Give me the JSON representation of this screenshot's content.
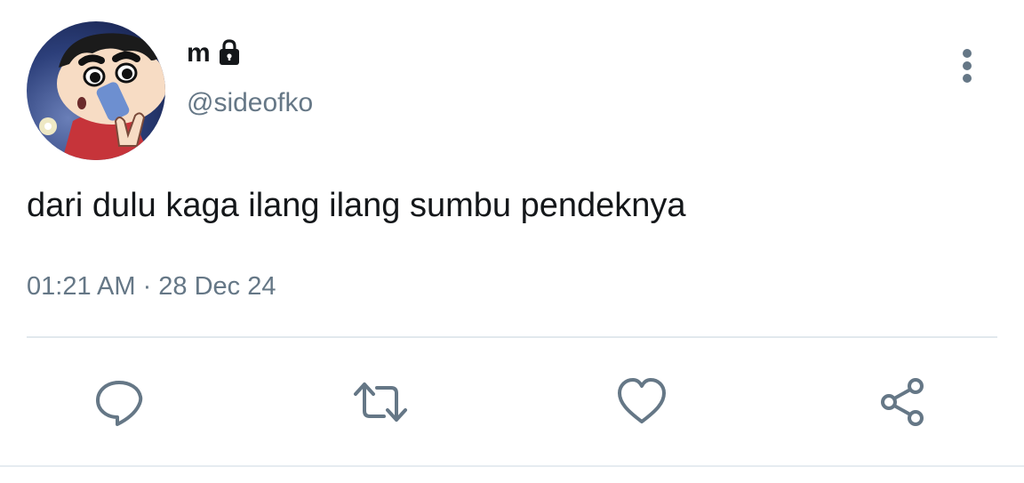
{
  "user": {
    "display_name": "m",
    "handle": "@sideofko",
    "protected_icon": "lock-icon",
    "avatar_icon": "cartoon-avatar"
  },
  "tweet": {
    "text": "dari dulu kaga ilang ilang sumbu pendeknya",
    "timestamp": "01:21 AM · 28 Dec 24"
  },
  "actions": [
    {
      "name": "reply",
      "icon": "comment-icon"
    },
    {
      "name": "retweet",
      "icon": "retweet-icon"
    },
    {
      "name": "like",
      "icon": "heart-icon"
    },
    {
      "name": "share",
      "icon": "share-icon"
    }
  ],
  "menu_icon": "more-vertical-icon",
  "colors": {
    "text": "#14171a",
    "secondary": "#657786",
    "divider": "#e1e8ed"
  }
}
